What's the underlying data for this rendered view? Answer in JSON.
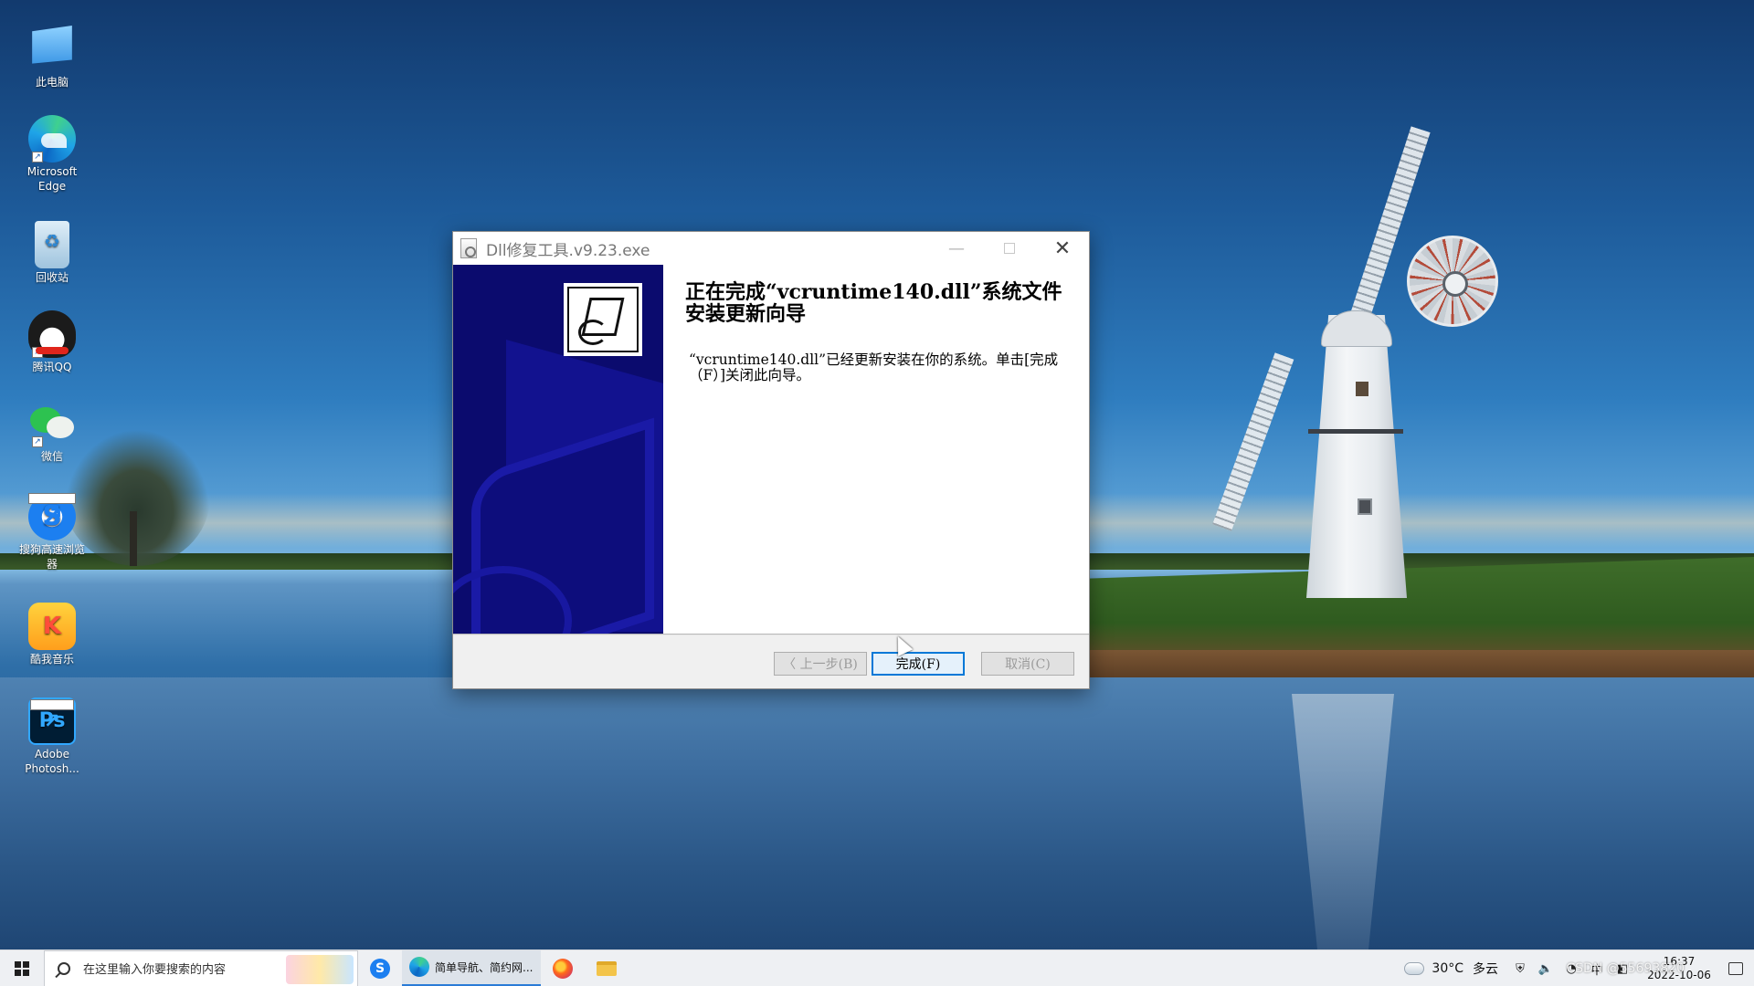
{
  "desktop": {
    "icons": [
      {
        "label": "此电脑",
        "icon": "computer-icon"
      },
      {
        "label": "Microsoft Edge",
        "icon": "edge-icon"
      },
      {
        "label": "回收站",
        "icon": "recycle-bin-icon"
      },
      {
        "label": "腾讯QQ",
        "icon": "qq-icon"
      },
      {
        "label": "微信",
        "icon": "wechat-icon"
      },
      {
        "label": "搜狗高速浏览器",
        "icon": "sogou-browser-icon"
      },
      {
        "label": "酷我音乐",
        "icon": "kuwo-music-icon"
      },
      {
        "label": "Adobe Photosh...",
        "icon": "photoshop-icon"
      }
    ]
  },
  "dialog": {
    "title": "Dll修复工具.v9.23.exe",
    "heading": "正在完成“vcruntime140.dll”系统文件安装更新向导",
    "message": "“vcruntime140.dll”已经更新安装在你的系统。单击[完成（F）]关闭此向导。",
    "buttons": {
      "back": "〈 上一步(B)",
      "finish": "完成(F)",
      "cancel": "取消(C)"
    },
    "controls": {
      "minimize": "—",
      "close": "✕"
    }
  },
  "taskbar": {
    "search_placeholder": "在这里输入你要搜索的内容",
    "edge_label": "简单导航、简约网...",
    "weather_temp": "30°C",
    "weather_desc": "多云",
    "clock_time": "16:37",
    "clock_date": "2022-10-06",
    "watermark": "CSDN @55693820"
  }
}
